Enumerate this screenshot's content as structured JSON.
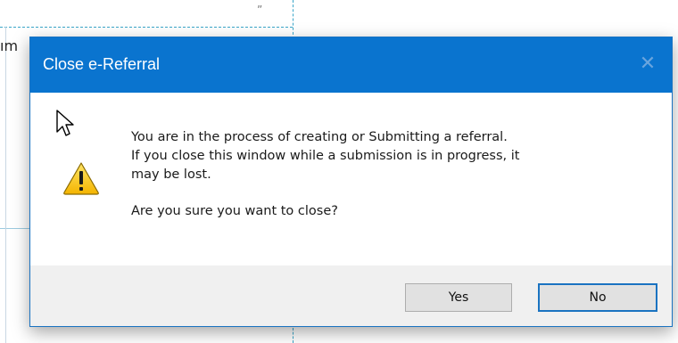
{
  "background": {
    "partial_text": "ım",
    "quote_mark": "”"
  },
  "dialog": {
    "title": "Close e-Referral",
    "close_glyph": "✕",
    "icon": "warning-icon",
    "message_lines": [
      "You are in the process of creating or Submitting a referral.",
      "If you close this window while a submission is in progress, it",
      "may be lost."
    ],
    "question": "Are you sure you want to close?",
    "buttons": {
      "yes": "Yes",
      "no": "No"
    }
  },
  "colors": {
    "titlebar": "#0a74cf",
    "footer": "#f0f0f0",
    "focus_border": "#1a73c1"
  },
  "cursor": "arrow-cursor-icon"
}
